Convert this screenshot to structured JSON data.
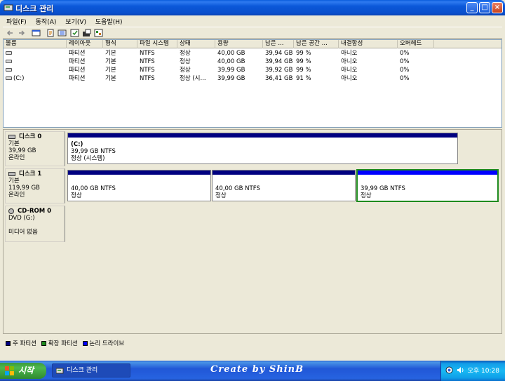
{
  "window": {
    "title": "디스크 관리",
    "minimize": "_",
    "maximize": "□",
    "close": "×"
  },
  "menu": [
    "파일(F)",
    "동작(A)",
    "보기(V)",
    "도움말(H)"
  ],
  "toolbar": [
    "back-icon",
    "forward-icon",
    "console-icon",
    "properties-icon",
    "list-icon",
    "help-icon",
    "export-icon",
    "settings-icon"
  ],
  "volume_list": {
    "headers": [
      "볼륨",
      "레이아웃",
      "형식",
      "파일 시스템",
      "상태",
      "용량",
      "남은 ...",
      "남은 공간 ...",
      "내결함성",
      "오버헤드"
    ],
    "rows": [
      [
        "",
        "파티션",
        "기본",
        "NTFS",
        "정상",
        "40,00 GB",
        "39,94 GB",
        "99 %",
        "아니오",
        "0%"
      ],
      [
        "",
        "파티션",
        "기본",
        "NTFS",
        "정상",
        "40,00 GB",
        "39,94 GB",
        "99 %",
        "아니오",
        "0%"
      ],
      [
        "",
        "파티션",
        "기본",
        "NTFS",
        "정상",
        "39,99 GB",
        "39,92 GB",
        "99 %",
        "아니오",
        "0%"
      ],
      [
        "(C:)",
        "파티션",
        "기본",
        "NTFS",
        "정상 (시...",
        "39,99 GB",
        "36,41 GB",
        "91 %",
        "아니오",
        "0%"
      ]
    ]
  },
  "disks": [
    {
      "name": "디스크 0",
      "type": "기본",
      "size": "39,99 GB",
      "status": "온라인",
      "partitions": [
        {
          "title": "(C:)",
          "size": "39,99 GB NTFS",
          "status": "정상 (시스템)"
        }
      ]
    },
    {
      "name": "디스크 1",
      "type": "기본",
      "size": "119,99 GB",
      "status": "온라인",
      "partitions": [
        {
          "title": "",
          "size": "40,00 GB NTFS",
          "status": "정상"
        },
        {
          "title": "",
          "size": "40,00 GB NTFS",
          "status": "정상"
        },
        {
          "title": "",
          "size": "39,99 GB NTFS",
          "status": "정상"
        }
      ]
    },
    {
      "name": "CD-ROM 0",
      "type": "DVD (G:)",
      "size": "",
      "status": "미디어 없음",
      "partitions": []
    }
  ],
  "legend": [
    {
      "label": "주 파티션",
      "color": "#000080"
    },
    {
      "label": "확장 파티션",
      "color": "#1E8B1E"
    },
    {
      "label": "논리 드라이브",
      "color": "#0000FF"
    }
  ],
  "colors": {
    "primary_bar": "#000080",
    "logical_bar": "#0000FF",
    "selected_border": "#1E8B1E"
  },
  "taskbar": {
    "start_label": "시작",
    "task_label": "디스크 관리",
    "watermark": "Create by ShinB",
    "clock": "오후 10:28"
  }
}
